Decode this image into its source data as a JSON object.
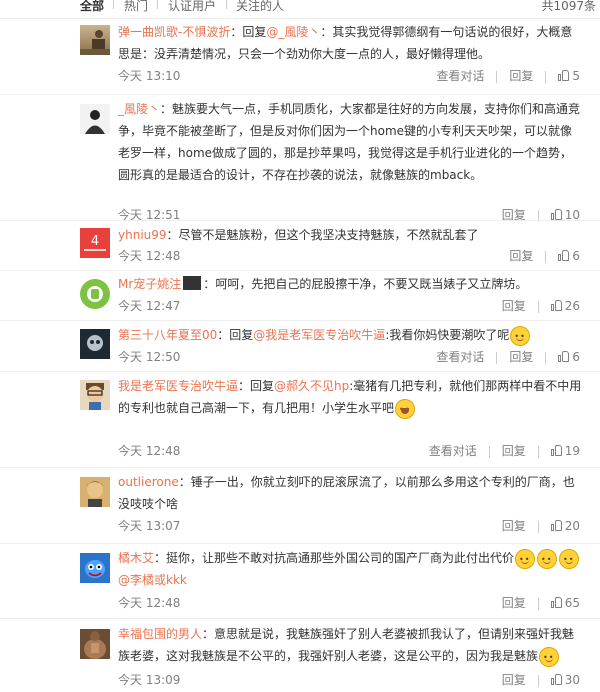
{
  "tabs": [
    "全部",
    "热门",
    "认证用户",
    "关注的人"
  ],
  "count_label": "共1097条",
  "comments": [
    {
      "user": "弹一曲凯歌-不惧波折",
      "prefix": "：回复",
      "mention": "@_風陵丶",
      "text": "：其实我觉得郭德纲有一句话说的很好，大概意思是：没弄清楚情况，只会一个劲劝你大度一点的人，最好懒得理他。",
      "mention2": "",
      "time": "今天 13:10",
      "view_conv": "查看对话",
      "reply": "回复",
      "likes": "5"
    },
    {
      "user": "_風陵丶",
      "prefix": "：",
      "mention": "",
      "text": "魅族要大气一点，手机同质化，大家都是往好的方向发展，支持你们和高通竞争，毕竟不能被垄断了，但是反对你们因为一个home键的小专利天天吵架，可以就像老罗一样，home做成了圆的，那是抄苹果吗，我觉得这是手机行业进化的一个趋势，圆形真的是最适合的设计，不存在抄袭的说法，就像魅族的mback。",
      "mention2": "",
      "time": "今天 12:51",
      "view_conv": "",
      "reply": "回复",
      "likes": "10"
    },
    {
      "user": "yhniu99",
      "prefix": "：",
      "mention": "",
      "text": "尽管不是魅族粉，但这个我坚决支持魅族，不然就乱套了",
      "mention2": "",
      "time": "今天 12:48",
      "view_conv": "",
      "reply": "回复",
      "likes": "6"
    },
    {
      "user": "Mr宠子姚注",
      "prefix": "：",
      "mention": "",
      "text": "呵呵，先把自己的屁股擦干净，不要又既当婊子又立牌坊。",
      "mention2": "",
      "time": "今天 12:47",
      "view_conv": "",
      "reply": "回复",
      "likes": "26"
    },
    {
      "user": "第三十八年夏至00",
      "prefix": "：回复",
      "mention": "@我是老军医专治吹牛逼",
      "text": ":我看你妈快要潮吹了呢",
      "mention2": "",
      "time": "今天 12:50",
      "view_conv": "查看对话",
      "reply": "回复",
      "likes": "6"
    },
    {
      "user": "我是老军医专治吹牛逼",
      "prefix": "：回复",
      "mention": "@郝久不见hp",
      "text": ":毫猪有几把专利，就他们那两样中看不中用的专利也就自己高潮一下，有几把用！小学生水平吧",
      "mention2": "",
      "time": "今天 12:48",
      "view_conv": "查看对话",
      "reply": "回复",
      "likes": "19"
    },
    {
      "user": "outlierone",
      "prefix": "：",
      "mention": "",
      "text": "锤子一出，你就立刻吓的屁滚尿流了，以前那么多用这个专利的厂商，也没吱吱个啥",
      "mention2": "",
      "time": "今天 13:07",
      "view_conv": "",
      "reply": "回复",
      "likes": "20"
    },
    {
      "user": "橘木艾",
      "prefix": "：",
      "mention": "",
      "text": "挺你，让那些不敢对抗高通那些外国公司的国产厂商为此付出代价",
      "mention2": "@李橘或kkk",
      "time": "今天 12:48",
      "view_conv": "",
      "reply": "回复",
      "likes": "65"
    },
    {
      "user": "幸福包围的男人",
      "prefix": "：",
      "mention": "",
      "text": "意思就是说，我魅族强奸了别人老婆被抓我认了，但请别来强奸我魅族老婆，这对我魅族是不公平的，我强奸别人老婆，这是公平的，因为我是魅族",
      "mention2": "",
      "time": "今天 13:09",
      "view_conv": "",
      "reply": "回复",
      "likes": "30"
    }
  ]
}
